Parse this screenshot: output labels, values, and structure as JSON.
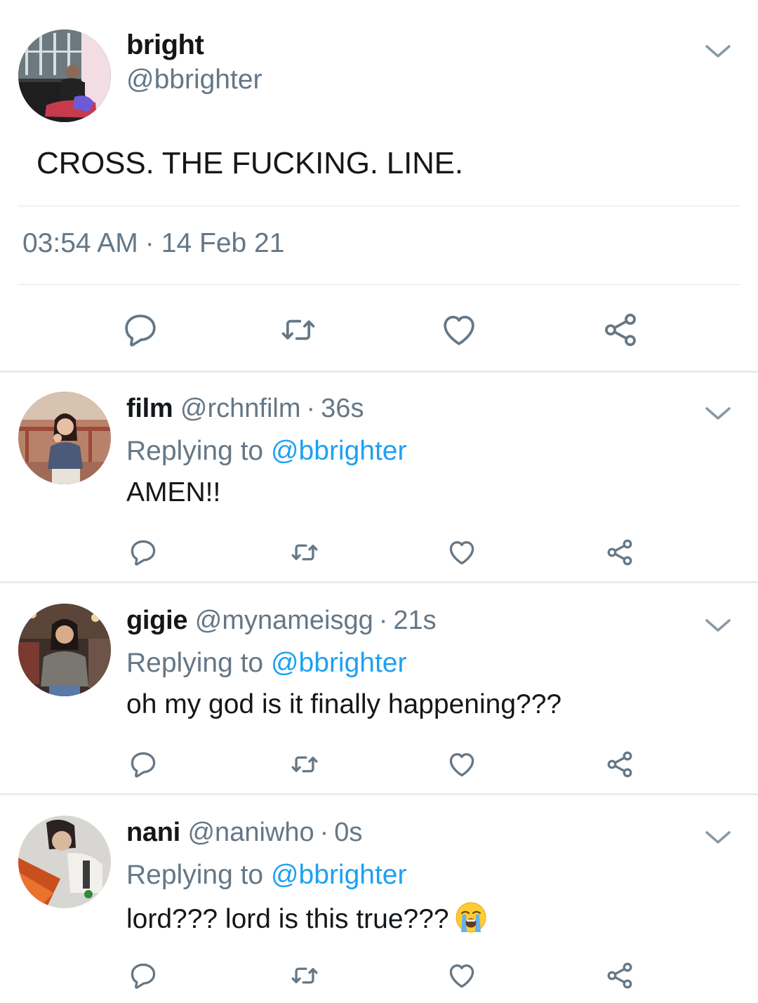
{
  "main_tweet": {
    "name": "bright",
    "handle": "@bbrighter",
    "text": "CROSS. THE FUCKING. LINE.",
    "time": "03:54 AM",
    "separator": "·",
    "date": "14 Feb 21"
  },
  "replies": [
    {
      "name": "film",
      "handle": "@rchnfilm",
      "separator": "·",
      "age": "36s",
      "replying_prefix": "Replying to",
      "replying_to": "@bbrighter",
      "text": "AMEN!!"
    },
    {
      "name": "gigie",
      "handle": "@mynameisgg",
      "separator": "·",
      "age": "21s",
      "replying_prefix": "Replying to",
      "replying_to": "@bbrighter",
      "text": "oh my god is it finally happening???"
    },
    {
      "name": "nani",
      "handle": "@naniwho",
      "separator": "·",
      "age": "0s",
      "replying_prefix": "Replying to",
      "replying_to": "@bbrighter",
      "text": "lord??? lord is this true???",
      "emoji": "loudly-crying-face-emoji"
    }
  ],
  "actions": [
    "reply-icon",
    "retweet-icon",
    "like-icon",
    "share-icon"
  ],
  "colors": {
    "text": "#14171a",
    "secondary": "#657786",
    "mention": "#1da1f2",
    "divider": "#e1e8ed"
  }
}
